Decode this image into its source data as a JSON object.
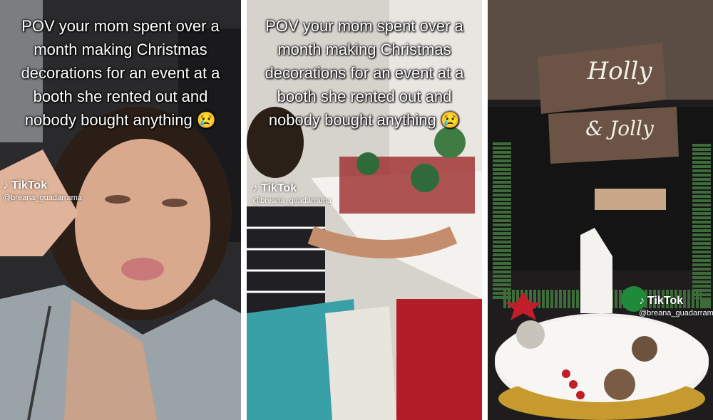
{
  "panels": [
    {
      "caption": "POV your mom spent over a month making Christmas decorations for an event at a booth she rented out and nobody bought anything 😢",
      "watermark": {
        "brand": "TikTok",
        "handle": "@breana_guadarrama"
      }
    },
    {
      "caption": "POV your mom spent over a month making Christmas decorations for an event at a booth she rented out and nobody bought anything 😢",
      "watermark": {
        "brand": "TikTok",
        "handle": "@breana_guadarrama"
      }
    },
    {
      "sign_top": "Holly",
      "sign_bottom": "& Jolly",
      "watermark": {
        "brand": "TikTok",
        "handle": "@breana_guadarrama"
      }
    }
  ],
  "icons": {
    "tiktok": "tiktok-note-icon"
  }
}
